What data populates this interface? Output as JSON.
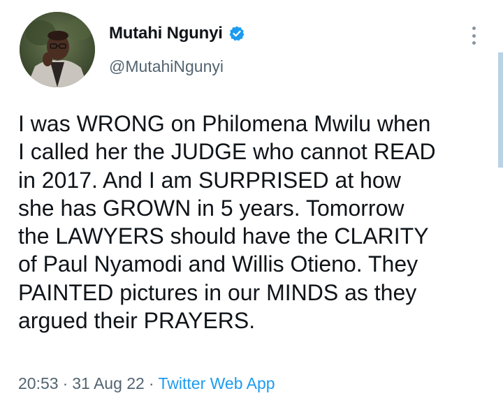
{
  "author": {
    "display_name": "Mutahi Ngunyi",
    "handle": "@MutahiNgunyi",
    "verified": true,
    "verified_icon": "verified-badge-icon",
    "avatar_icon": "profile-photo"
  },
  "tweet": {
    "lines": [
      "I was WRONG on Philomena Mwilu when",
      "I called her the JUDGE who cannot READ",
      "in 2017. And I am SURPRISED at how",
      "she has GROWN in 5 years. Tomorrow",
      "the LAWYERS should have the CLARITY",
      "of Paul Nyamodi and Willis Otieno. They",
      "PAINTED pictures in our MINDS as they",
      "argued their PRAYERS."
    ]
  },
  "meta": {
    "time": "20:53",
    "separator": "·",
    "date": "31 Aug 22",
    "source": "Twitter Web App"
  },
  "menu": {
    "icon": "more-options-icon"
  },
  "colors": {
    "accent": "#1d9bf0",
    "muted_text": "#536471",
    "main_text": "#0f1419",
    "verified": "#1d9bf0"
  }
}
